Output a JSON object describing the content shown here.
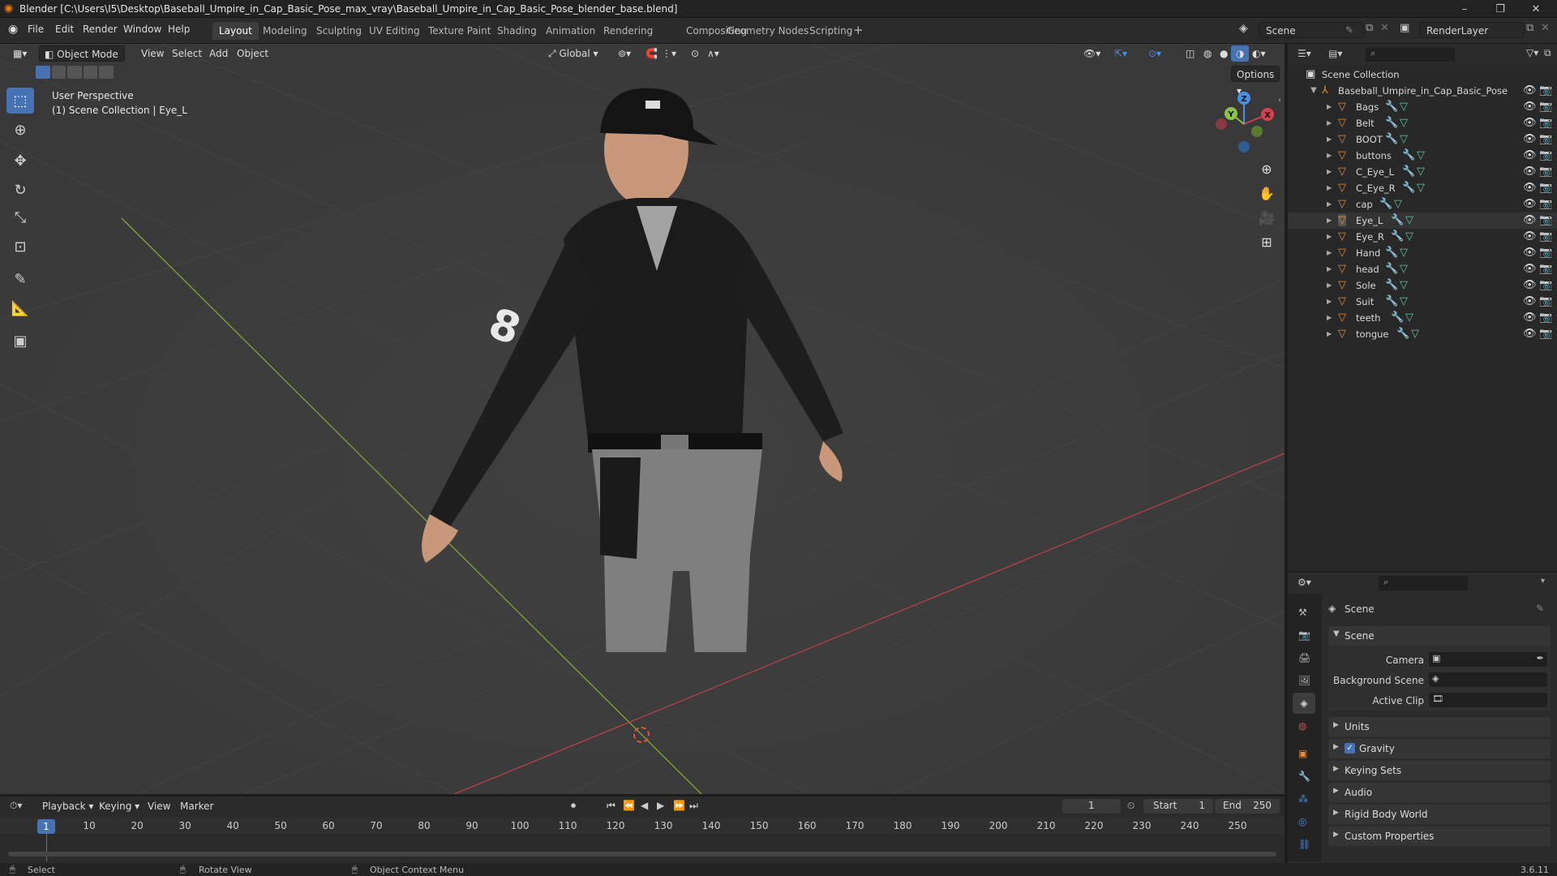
{
  "titlebar": {
    "title": "Blender [C:\\Users\\I5\\Desktop\\Baseball_Umpire_in_Cap_Basic_Pose_max_vray\\Baseball_Umpire_in_Cap_Basic_Pose_blender_base.blend]",
    "minimize": "–",
    "maximize": "❐",
    "close": "✕"
  },
  "menu": {
    "file": "File",
    "edit": "Edit",
    "render": "Render",
    "window": "Window",
    "help": "Help"
  },
  "workspaces": [
    "Layout",
    "Modeling",
    "Sculpting",
    "UV Editing",
    "Texture Paint",
    "Shading",
    "Animation",
    "Rendering",
    "Compositing",
    "Geometry Nodes",
    "Scripting"
  ],
  "add_workspace": "+",
  "scene_selector": "Scene",
  "renderlayer_selector": "RenderLayer",
  "viewport_header": {
    "mode": "Object Mode",
    "view": "View",
    "select": "Select",
    "add": "Add",
    "object": "Object",
    "transform_orientation": "Global",
    "options": "Options"
  },
  "viewport": {
    "perspective_label": "User Perspective",
    "collection_label": "(1) Scene Collection | Eye_L",
    "axis_x": "X",
    "axis_y": "Y",
    "axis_z": "Z"
  },
  "outliner": {
    "root": "Scene Collection",
    "collection": "Baseball_Umpire_in_Cap_Basic_Pose",
    "items": [
      "Bags",
      "Belt",
      "BOOT",
      "buttons",
      "C_Eye_L",
      "C_Eye_R",
      "cap",
      "Eye_L",
      "Eye_R",
      "Hand",
      "head",
      "Sole",
      "Suit",
      "teeth",
      "tongue"
    ],
    "selected": "Eye_L"
  },
  "properties": {
    "context": "Scene",
    "panel_scene": "Scene",
    "camera_label": "Camera",
    "background_scene_label": "Background Scene",
    "active_clip_label": "Active Clip",
    "panels": [
      "Units",
      "Gravity",
      "Keying Sets",
      "Audio",
      "Rigid Body World",
      "Custom Properties"
    ],
    "gravity_checked": true
  },
  "timeline": {
    "playback": "Playback",
    "keying": "Keying",
    "view": "View",
    "marker": "Marker",
    "current_frame": "1",
    "start_label": "Start",
    "start": "1",
    "end_label": "End",
    "end": "250",
    "ruler": [
      "1",
      "10",
      "20",
      "30",
      "40",
      "50",
      "60",
      "70",
      "80",
      "90",
      "100",
      "110",
      "120",
      "130",
      "140",
      "150",
      "160",
      "170",
      "180",
      "190",
      "200",
      "210",
      "220",
      "230",
      "240",
      "250"
    ]
  },
  "statusbar": {
    "select": "Select",
    "rotate_view": "Rotate View",
    "context_menu": "Object Context Menu",
    "version": "3.6.11"
  },
  "colors": {
    "accent": "#4772b3",
    "mesh_icon": "#e58c3a",
    "x_axis": "#d4424f",
    "y_axis": "#8bc34a",
    "z_axis": "#4a8fe0"
  }
}
